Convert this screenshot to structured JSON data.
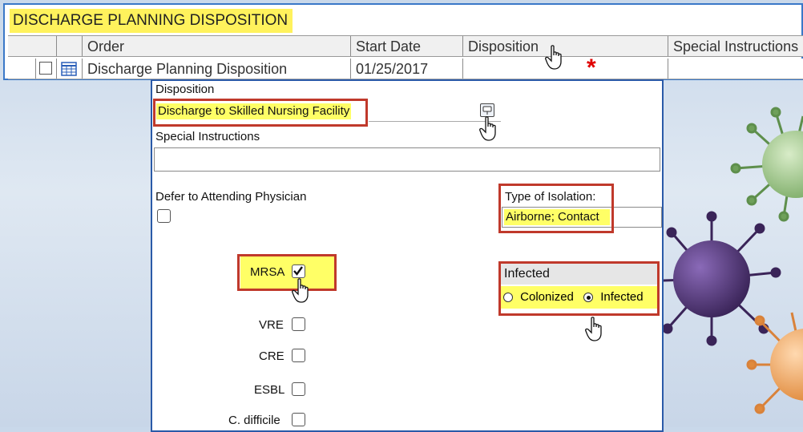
{
  "order_window": {
    "title": "DISCHARGE PLANNING DISPOSITION",
    "columns": [
      "Order",
      "Start Date",
      "Disposition",
      "Special Instructions"
    ],
    "row": {
      "order": "Discharge Planning Disposition",
      "start_date": "01/25/2017",
      "disposition": "",
      "special_instructions": ""
    },
    "required_marker": "*"
  },
  "form": {
    "disposition_label": "Disposition",
    "disposition_value": "Discharge to Skilled Nursing Facility",
    "special_instructions_label": "Special Instructions",
    "special_instructions_value": "",
    "defer_label": "Defer to Attending Physician",
    "defer_checked": false,
    "isolation_label": "Type of Isolation:",
    "isolation_value": "Airborne; Contact",
    "infected_label": "Infected",
    "radio_options": [
      {
        "label": "Colonized",
        "selected": false
      },
      {
        "label": "Infected",
        "selected": true
      }
    ],
    "organisms": [
      {
        "label": "MRSA",
        "checked": true
      },
      {
        "label": "VRE",
        "checked": false
      },
      {
        "label": "CRE",
        "checked": false
      },
      {
        "label": "ESBL",
        "checked": false
      },
      {
        "label": "C. difficile",
        "checked": false
      }
    ]
  },
  "colors": {
    "highlight": "#ffff66",
    "callout_border": "#c0392b",
    "window_border": "#3a78c8",
    "required_star": "#e00000"
  }
}
